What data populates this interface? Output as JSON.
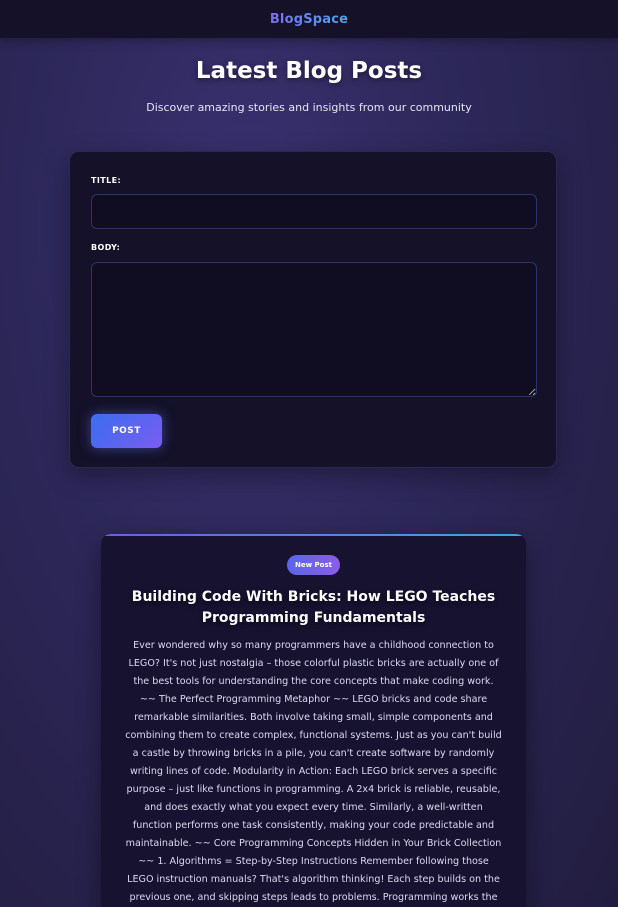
{
  "header": {
    "brand": "BlogSpace"
  },
  "hero": {
    "title": "Latest Blog Posts",
    "subtitle": "Discover amazing stories and insights from our community"
  },
  "form": {
    "title_label": "TITLE:",
    "title_value": "",
    "body_label": "BODY:",
    "body_value": "",
    "submit_label": "POST"
  },
  "post": {
    "badge": "New Post",
    "title": "Building Code With Bricks: How LEGO Teaches Programming Fundamentals",
    "body": "Ever wondered why so many programmers have a childhood connection to LEGO? It's not just nostalgia – those colorful plastic bricks are actually one of the best tools for understanding the core concepts that make coding work. ~~ The Perfect Programming Metaphor ~~ LEGO bricks and code share remarkable similarities. Both involve taking small, simple components and combining them to create complex, functional systems. Just as you can't build a castle by throwing bricks in a pile, you can't create software by randomly writing lines of code. Modularity in Action: Each LEGO brick serves a specific purpose – just like functions in programming. A 2x4 brick is reliable, reusable, and does exactly what you expect every time. Similarly, a well-written function performs one task consistently, making your code predictable and maintainable. ~~ Core Programming Concepts Hidden in Your Brick Collection ~~ 1. Algorithms = Step-by-Step Instructions Remember following those LEGO instruction manuals? That's algorithm thinking! Each step builds on the previous one, and skipping steps leads to problems. Programming works the same way – you break down"
  },
  "colors": {
    "topbar": "#141129",
    "card": "#141129",
    "accent_start": "#3a6ef0",
    "accent_end": "#7a5cf0",
    "input_border": "#2a3466"
  }
}
